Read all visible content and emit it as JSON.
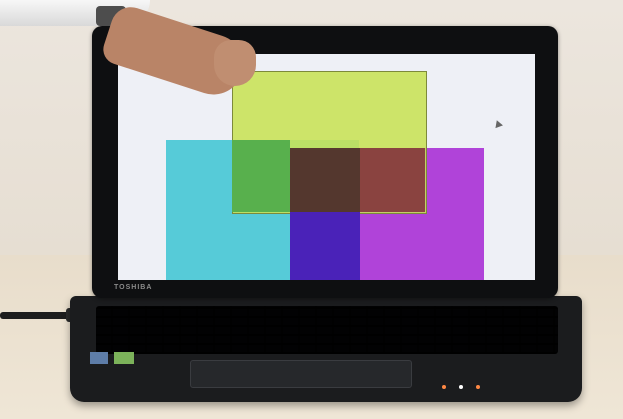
{
  "laptop": {
    "brand_label": "TOSHIBA"
  },
  "screen": {
    "shapes": [
      {
        "name": "cyan-rectangle",
        "color": "#56cbd8"
      },
      {
        "name": "purple-rectangle",
        "color": "#b043d9"
      },
      {
        "name": "yellow-rectangle",
        "color": "#c8e155"
      }
    ],
    "overlaps": [
      {
        "name": "green-overlap",
        "color": "#58b04d"
      },
      {
        "name": "brown-overlap",
        "color": "#54372e"
      },
      {
        "name": "red-overlap",
        "color": "#8a4340"
      },
      {
        "name": "navy-overlap",
        "color": "#4a22b8"
      }
    ]
  },
  "status_leds": [
    "orange",
    "white",
    "orange"
  ]
}
